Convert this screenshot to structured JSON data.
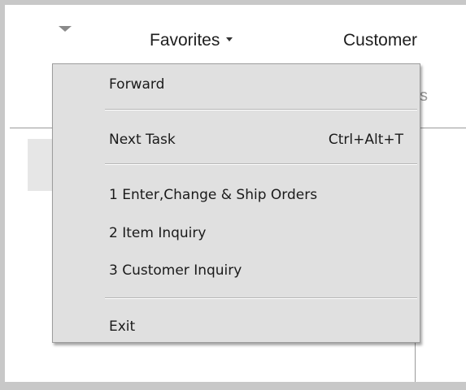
{
  "menubar": {
    "favorites_label": "Favorites",
    "customer_label": "Customer",
    "peek_label": "s"
  },
  "menu": {
    "forward": "Forward",
    "next_task": "Next Task",
    "next_task_shortcut": "Ctrl+Alt+T",
    "favorites": [
      "1 Enter,Change & Ship Orders",
      "2 Item Inquiry",
      "3 Customer Inquiry"
    ],
    "exit": "Exit"
  },
  "icons": {
    "menubar_dropdown": "chevron-down-icon",
    "favorites_dropdown": "caret-down-icon"
  },
  "colors": {
    "menu_background": "#e0e0e0",
    "page_border": "#c8c8c8"
  }
}
